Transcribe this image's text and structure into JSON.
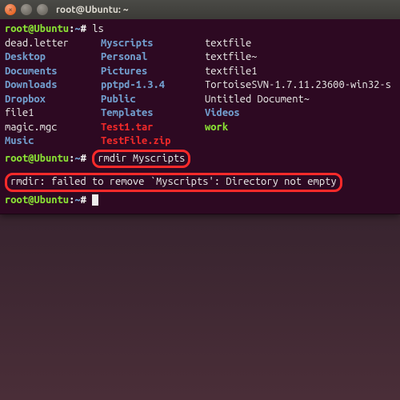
{
  "titlebar": {
    "title": "root@Ubuntu: ~"
  },
  "prompt": {
    "user_host": "root@Ubuntu",
    "path": "~",
    "colon": ":",
    "sign": "#"
  },
  "commands": {
    "ls": "ls",
    "rmdir": "rmdir Myscripts"
  },
  "ls_output": [
    {
      "c1": {
        "t": "dead.letter",
        "cls": "plain"
      },
      "c2": {
        "t": "Myscripts",
        "cls": "dir"
      },
      "c3": {
        "t": "textfile",
        "cls": "plain"
      }
    },
    {
      "c1": {
        "t": "Desktop",
        "cls": "dir"
      },
      "c2": {
        "t": "Personal",
        "cls": "dir"
      },
      "c3": {
        "t": "textfile~",
        "cls": "plain"
      }
    },
    {
      "c1": {
        "t": "Documents",
        "cls": "dir"
      },
      "c2": {
        "t": "Pictures",
        "cls": "dir"
      },
      "c3": {
        "t": "textfile1",
        "cls": "plain"
      }
    },
    {
      "c1": {
        "t": "Downloads",
        "cls": "dir"
      },
      "c2": {
        "t": "pptpd-1.3.4",
        "cls": "dir"
      },
      "c3": {
        "t": "TortoiseSVN-1.7.11.23600-win32-s",
        "cls": "plain"
      }
    },
    {
      "c1": {
        "t": "Dropbox",
        "cls": "dir"
      },
      "c2": {
        "t": "Public",
        "cls": "dir"
      },
      "c3": {
        "t": "Untitled Document~",
        "cls": "plain"
      }
    },
    {
      "c1": {
        "t": "file1",
        "cls": "plain"
      },
      "c2": {
        "t": "Templates",
        "cls": "dir"
      },
      "c3": {
        "t": "Videos",
        "cls": "dir"
      }
    },
    {
      "c1": {
        "t": "magic.mgc",
        "cls": "plain"
      },
      "c2": {
        "t": "Test1.tar",
        "cls": "tar"
      },
      "c3": {
        "t": "work",
        "cls": "exec"
      }
    },
    {
      "c1": {
        "t": "Music",
        "cls": "dir"
      },
      "c2": {
        "t": "TestFile.zip",
        "cls": "tar"
      },
      "c3": {
        "t": "",
        "cls": "plain"
      }
    }
  ],
  "error": "rmdir: failed to remove `Myscripts': Directory not empty",
  "colors": {
    "highlight_border": "#ff2a2a",
    "terminal_bg": "#2d0922",
    "dir": "#729fcf",
    "archive": "#ef2929",
    "exec": "#8ae234"
  }
}
